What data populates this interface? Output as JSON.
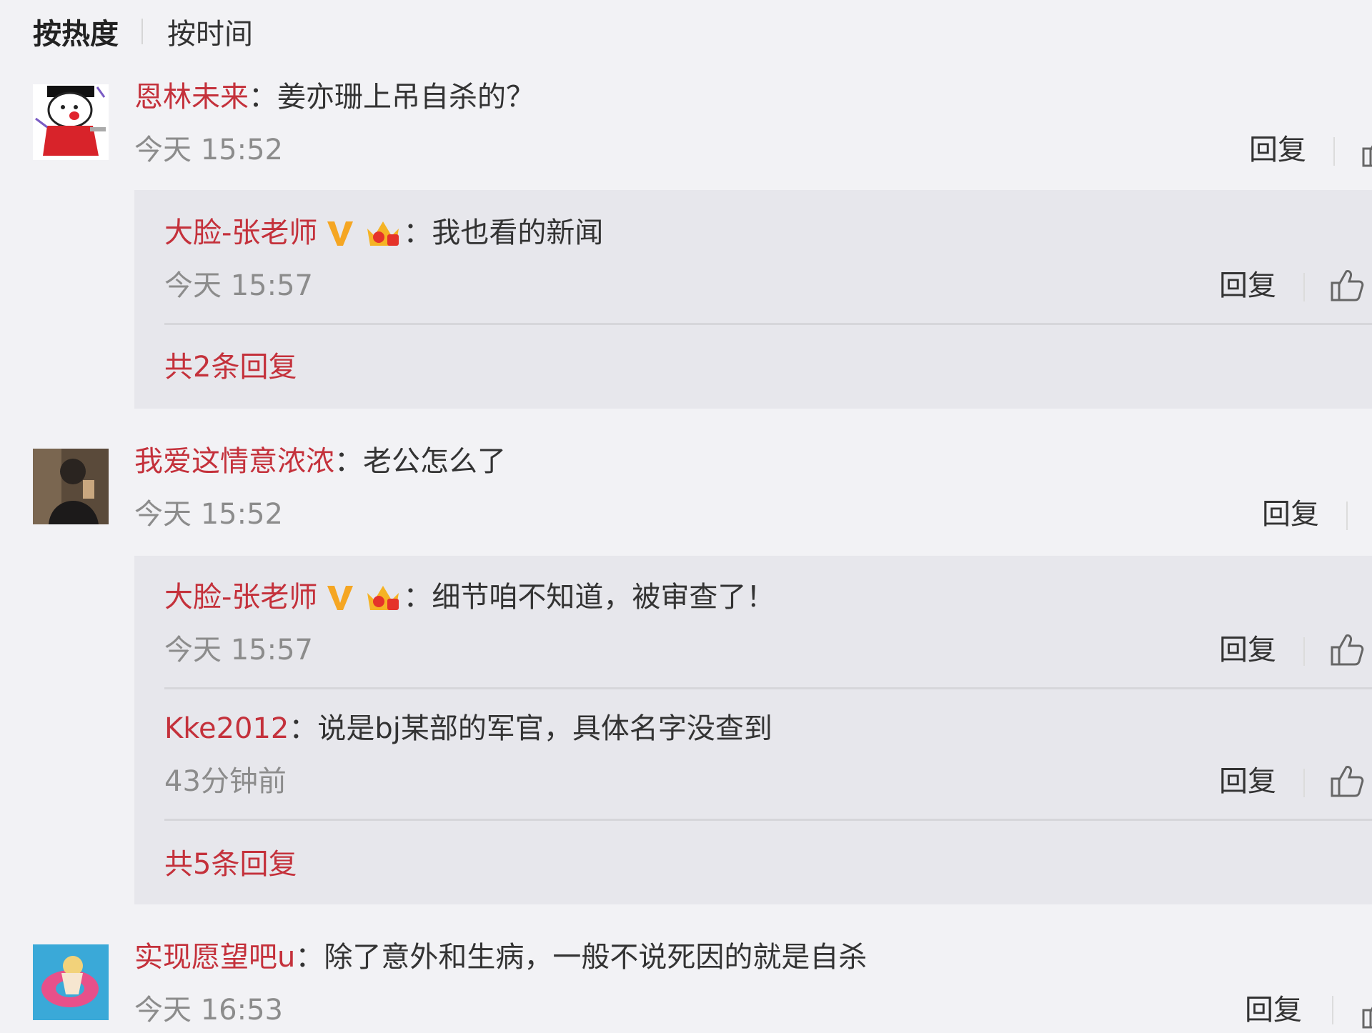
{
  "sort_tabs": {
    "hot": "按热度",
    "time": "按时间"
  },
  "colors": {
    "username": "#c4313b",
    "text": "#333333",
    "time": "#8c8c8c",
    "reply_bg": "#e7e7ec",
    "page_bg": "#f2f2f5"
  },
  "comments": [
    {
      "user": "恩林未来",
      "text": "：姜亦珊上吊自杀的？",
      "time": "今天 15:52",
      "reply_label": "回复",
      "replies": [
        {
          "user": "大脸-张老师",
          "text": "：我也看的新闻",
          "time": "今天 15:57",
          "reply_label": "回复",
          "badges": [
            "verified-v-icon",
            "crown-badge-icon"
          ]
        }
      ],
      "more": "共2条回复"
    },
    {
      "user": "我爱这情意浓浓",
      "text": "：老公怎么了",
      "time": "今天 15:52",
      "reply_label": "回复",
      "replies": [
        {
          "user": "大脸-张老师",
          "text": "：细节咱不知道，被审查了！",
          "time": "今天 15:57",
          "reply_label": "回复",
          "badges": [
            "verified-v-icon",
            "crown-badge-icon"
          ]
        },
        {
          "user": "Kke2012",
          "text": "：说是bj某部的军官，具体名字没查到",
          "time": "43分钟前",
          "reply_label": "回复"
        }
      ],
      "more": "共5条回复"
    },
    {
      "user": "实现愿望吧u",
      "text": "：除了意外和生病，一般不说死因的就是自杀",
      "time": "今天 16:53",
      "reply_label": "回复"
    }
  ]
}
